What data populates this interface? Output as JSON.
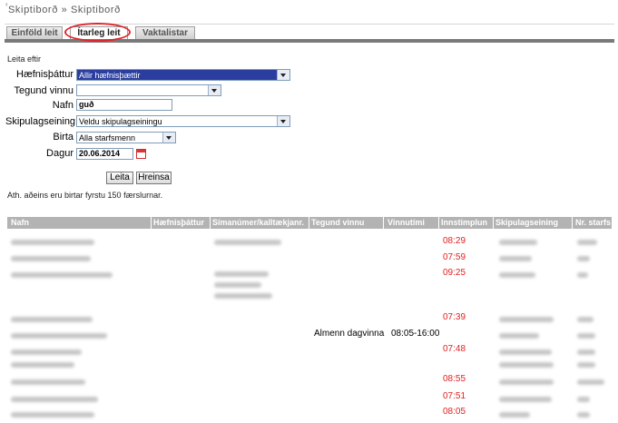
{
  "breadcrumb": "Skiptiborð » Skiptiborð",
  "tabs": [
    {
      "label": "Einföld leit",
      "active": false
    },
    {
      "label": "Ítarleg leit",
      "active": true
    },
    {
      "label": "Vaktalistar",
      "active": false
    }
  ],
  "form": {
    "heading": "Leita eftir",
    "hafnisthattur": {
      "label": "Hæfnisþáttur",
      "value": "Allir hæfnisþættir"
    },
    "tegund_vinnu": {
      "label": "Tegund vinnu",
      "value": ""
    },
    "nafn": {
      "label": "Nafn",
      "value": "guð"
    },
    "skipulagseining": {
      "label": "Skipulagseining",
      "value": "Veldu skipulagseiningu"
    },
    "birta": {
      "label": "Birta",
      "value": "Alla starfsmenn"
    },
    "dagur": {
      "label": "Dagur",
      "value": "20.06.2014"
    },
    "search_button": "Leita",
    "clear_button": "Hreinsa",
    "note": "Ath. aðeins eru birtar fyrstu 150 færslurnar."
  },
  "table": {
    "columns": [
      "Nafn",
      "Hæfnisþáttur",
      "Símanúmer/kalltækjanr.",
      "Tegund vinnu",
      "Vinnutími",
      "Innstimplun",
      "Skipulagseining",
      "Nr. starfs"
    ],
    "rows": [
      {
        "tegund": "",
        "vinnutimi": "",
        "innstimplun": "08:29"
      },
      {
        "tegund": "",
        "vinnutimi": "",
        "innstimplun": "07:59"
      },
      {
        "tegund": "",
        "vinnutimi": "",
        "innstimplun": "09:25"
      },
      {
        "tegund": "",
        "vinnutimi": "",
        "innstimplun": "07:39"
      },
      {
        "tegund": "Almenn dagvinna",
        "vinnutimi": "08:05-16:00",
        "innstimplun": ""
      },
      {
        "tegund": "",
        "vinnutimi": "",
        "innstimplun": "07:48"
      },
      {
        "tegund": "",
        "vinnutimi": "",
        "innstimplun": ""
      },
      {
        "tegund": "",
        "vinnutimi": "",
        "innstimplun": "08:55"
      },
      {
        "tegund": "",
        "vinnutimi": "",
        "innstimplun": "07:51"
      },
      {
        "tegund": "",
        "vinnutimi": "",
        "innstimplun": "08:05"
      }
    ]
  },
  "colors": {
    "accent_red": "#e02020",
    "header_gray": "#b3b3b3",
    "highlight_circle": "#e0262b"
  }
}
